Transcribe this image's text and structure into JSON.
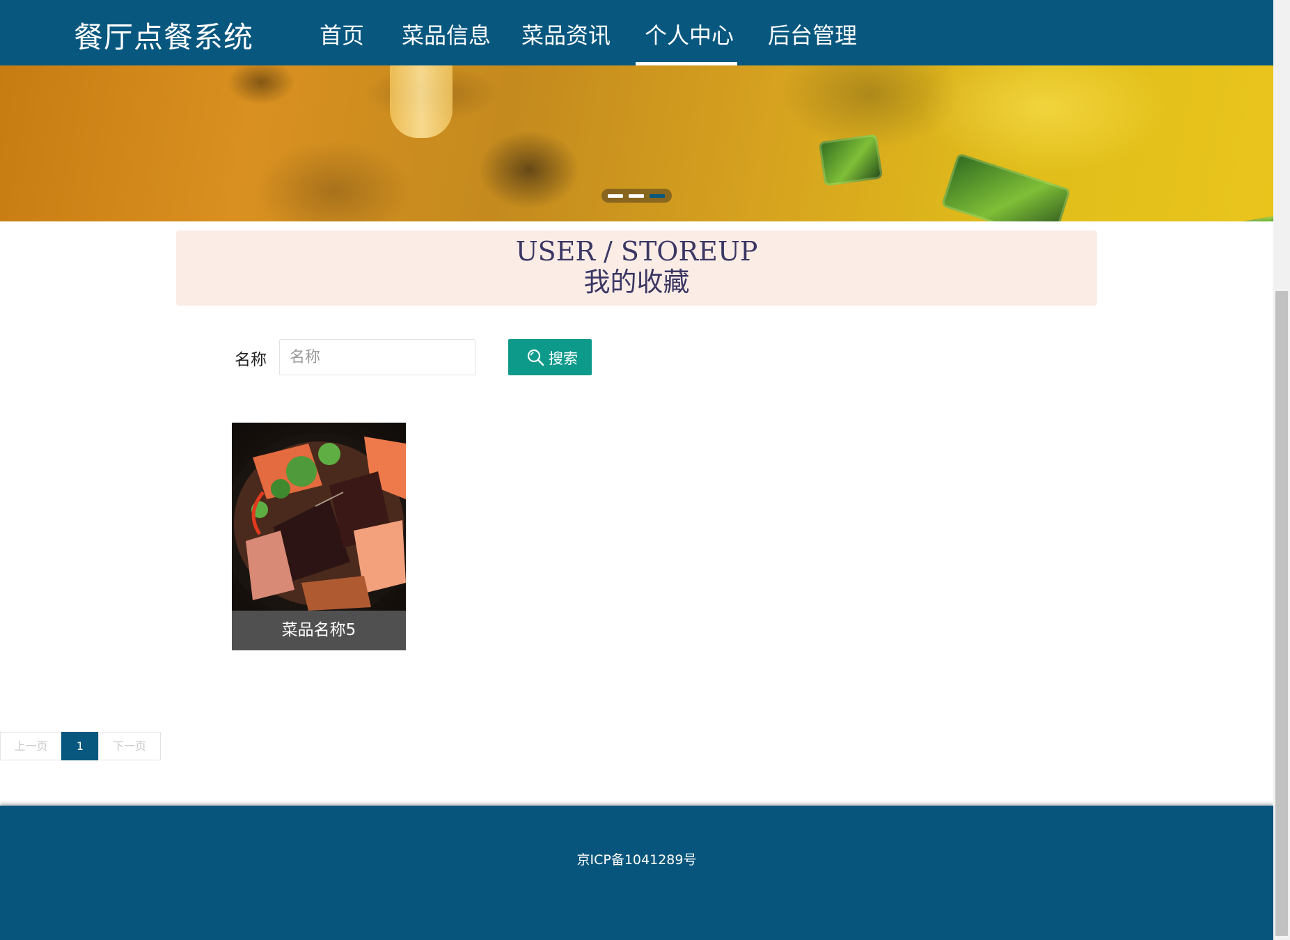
{
  "header": {
    "brand": "餐厅点餐系统",
    "nav": [
      {
        "label": "首页",
        "active": false
      },
      {
        "label": "菜品信息",
        "active": false
      },
      {
        "label": "菜品资讯",
        "active": false
      },
      {
        "label": "个人中心",
        "active": true
      },
      {
        "label": "后台管理",
        "active": false
      }
    ]
  },
  "banner": {
    "slide_count": 3,
    "active_slide": 3
  },
  "page_title": {
    "english": "USER / STOREUP",
    "chinese": "我的收藏"
  },
  "search": {
    "label": "名称",
    "placeholder": "名称",
    "value": "",
    "button_label": "搜索"
  },
  "items": [
    {
      "name": "菜品名称5"
    }
  ],
  "pagination": {
    "prev_label": "上一页",
    "current_page": "1",
    "next_label": "下一页"
  },
  "footer": {
    "text": "京ICP备1041289号"
  },
  "colors": {
    "primary": "#07577f",
    "search_button": "#0e9a8b",
    "title_box": "#fbede6",
    "title_text": "#3b3764",
    "card_caption": "#505050"
  },
  "icons": {
    "search_button_icon": "search-icon"
  }
}
